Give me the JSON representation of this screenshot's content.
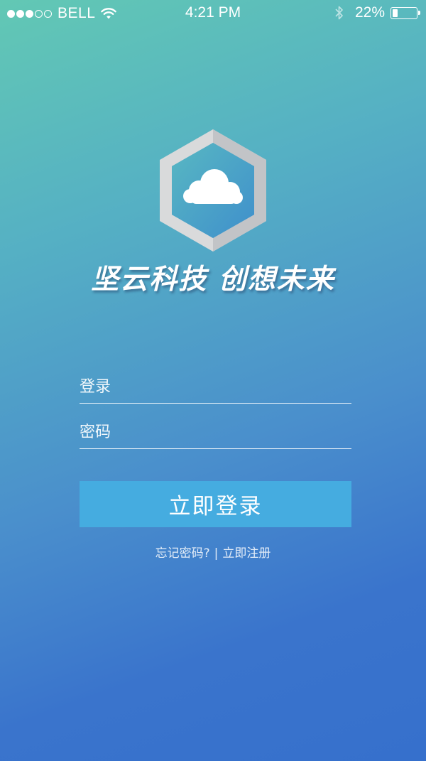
{
  "status_bar": {
    "carrier": "BELL",
    "time": "4:21 PM",
    "battery_percent": "22%",
    "battery_level": 0.22,
    "signal_bars_filled": 3,
    "signal_bars_total": 5
  },
  "brand": {
    "slogan": "坚云科技 创想未来",
    "logo_icon": "cloud-hexagon-icon"
  },
  "login_form": {
    "username_placeholder": "登录",
    "password_placeholder": "密码",
    "username_value": "",
    "password_value": "",
    "submit_label": "立即登录"
  },
  "links": {
    "forgot_password": "忘记密码?",
    "separator": "|",
    "register": "立即注册"
  },
  "colors": {
    "gradient_top": "#62c8b4",
    "gradient_bottom": "#3670cc",
    "button": "#45ace0",
    "text": "#ffffff"
  }
}
